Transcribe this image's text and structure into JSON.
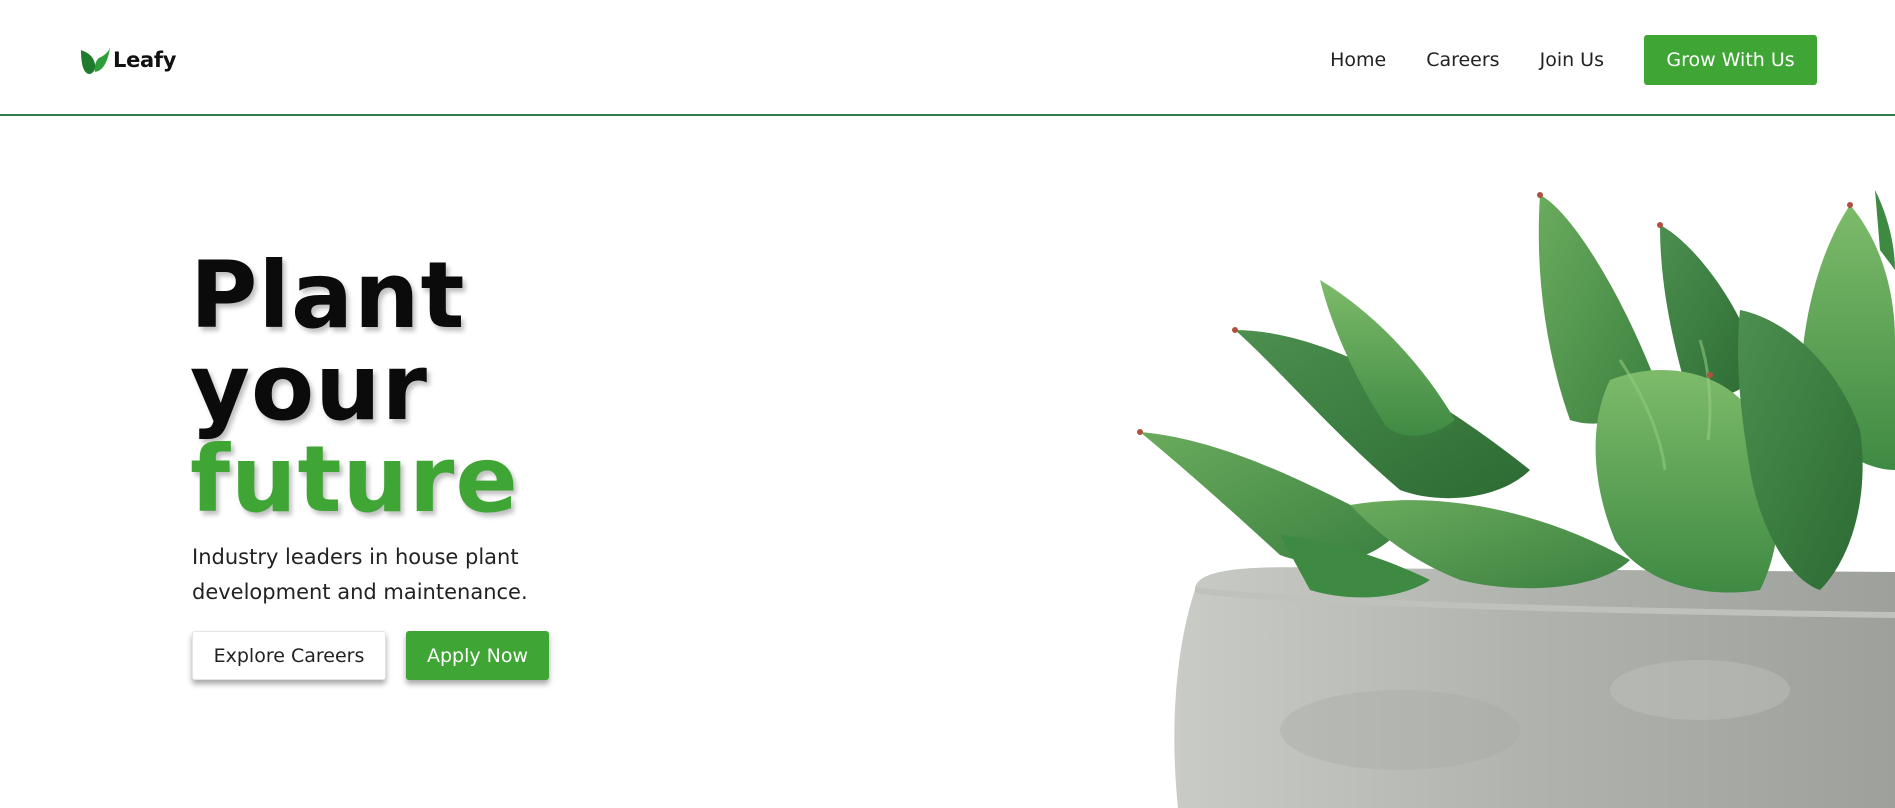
{
  "nav": {
    "brand": "Leafy",
    "links": [
      "Home",
      "Careers",
      "Join Us"
    ],
    "cta": "Grow With Us"
  },
  "hero": {
    "title_lines": [
      "Plant",
      "your",
      "future"
    ],
    "subtitle": "Industry leaders in house plant development and maintenance.",
    "explore_button": "Explore Careers",
    "apply_button": "Apply Now"
  },
  "colors": {
    "brand_green": "#3fa535",
    "nav_border": "#2e7d4a"
  },
  "icons": {
    "brand": "leaf-icon"
  }
}
